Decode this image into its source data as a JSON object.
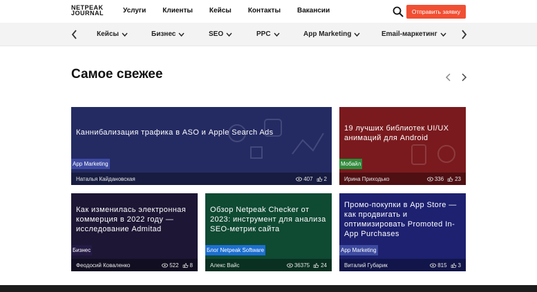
{
  "header": {
    "logo_line1": "NETPEAK",
    "logo_line2": "JOURNAL",
    "nav": [
      "Услуги",
      "Клиенты",
      "Кейсы",
      "Контакты",
      "Вакансии"
    ],
    "cta_label": "Отправить заявку",
    "cta_color": "#f14f33"
  },
  "categories": [
    "Кейсы",
    "Бизнес",
    "SEO",
    "PPC",
    "App Marketing",
    "Email-маркетинг"
  ],
  "section": {
    "title": "Самое свежее"
  },
  "cards": [
    {
      "title": "Каннибализация трафика в ASO и Apple Search Ads",
      "tag": "App Marketing",
      "author": "Наталья Кайдановская",
      "views": "407",
      "likes": "2",
      "bg": "#242b63",
      "tag_color": "#3d4aa0"
    },
    {
      "title": "19 лучших библиотек UI/UX анимаций для Android",
      "tag": "Мобайл",
      "author": "Ирина Приходько",
      "views": "336",
      "likes": "23",
      "bg": "#7a1a1e",
      "tag_color": "#2f8a3a"
    },
    {
      "title": "Как изменилась электронная коммерция в 2022 году — исследование Admitad",
      "tag": "Бизнес",
      "author": "Феодосий Коваленко",
      "views": "522",
      "likes": "8",
      "bg": "#1d1635",
      "tag_color": "#241a44"
    },
    {
      "title": "Обзор Netpeak Checker от 2023: инструмент для анализа SEO-метрик сайта",
      "tag": "Блог Netpeak Software",
      "author": "Алекс Вайс",
      "views": "36375",
      "likes": "24",
      "bg": "#0f4a33",
      "tag_color": "#1c6fd1"
    },
    {
      "title": "Промо-покупки в App Store — как продвигать и оптимизировать Promoted In-App Purchases",
      "tag": "App Marketing",
      "author": "Виталий Губарик",
      "views": "815",
      "likes": "3",
      "bg": "#1d2170",
      "tag_color": "#3d4aa0"
    }
  ]
}
